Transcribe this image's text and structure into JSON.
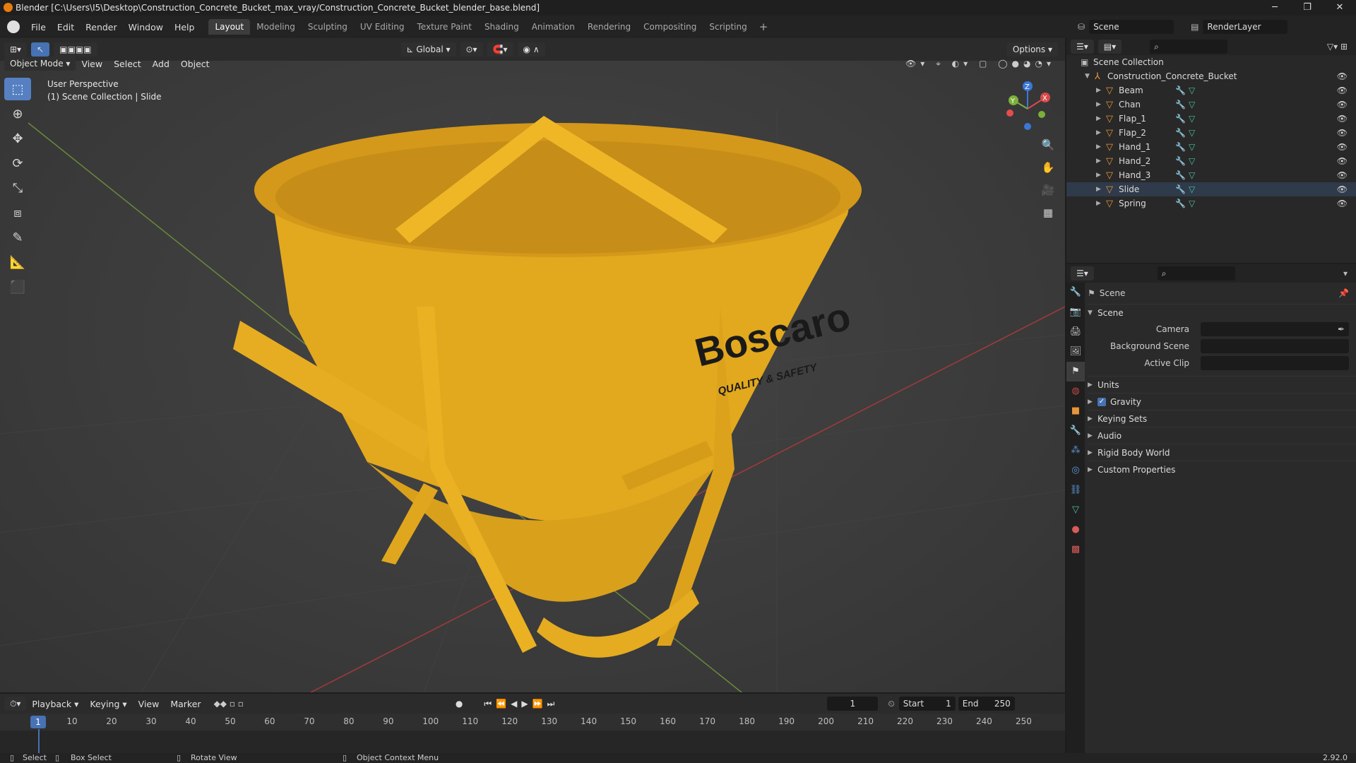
{
  "window": {
    "title": "Blender [C:\\Users\\I5\\Desktop\\Construction_Concrete_Bucket_max_vray/Construction_Concrete_Bucket_blender_base.blend]",
    "minimize": "─",
    "maximize": "❐",
    "close": "✕"
  },
  "menu": [
    "File",
    "Edit",
    "Render",
    "Window",
    "Help"
  ],
  "workspaces": [
    "Layout",
    "Modeling",
    "Sculpting",
    "UV Editing",
    "Texture Paint",
    "Shading",
    "Animation",
    "Rendering",
    "Compositing",
    "Scripting"
  ],
  "scene": {
    "scene_name": "Scene",
    "view_layer": "RenderLayer"
  },
  "viewport_header": {
    "transform": "Global",
    "options": "Options",
    "mode": "Object Mode",
    "menus": [
      "View",
      "Select",
      "Add",
      "Object"
    ]
  },
  "viewport_info": {
    "line1": "User Perspective",
    "line2": "(1) Scene Collection | Slide"
  },
  "gizmo": {
    "x": "X",
    "y": "Y",
    "z": "Z"
  },
  "model": {
    "brand": "Boscaro",
    "tagline": "QUALITY & SAFETY"
  },
  "timeline": {
    "menus": [
      "Playback",
      "Keying",
      "View",
      "Marker"
    ],
    "current_frame": "1",
    "start_label": "Start",
    "start": "1",
    "end_label": "End",
    "end": "250",
    "ticks": [
      "1",
      "10",
      "20",
      "30",
      "40",
      "50",
      "60",
      "70",
      "80",
      "90",
      "100",
      "110",
      "120",
      "130",
      "140",
      "150",
      "160",
      "170",
      "180",
      "190",
      "200",
      "210",
      "220",
      "230",
      "240",
      "250"
    ]
  },
  "statusbar": {
    "select": "Select",
    "box_select": "Box Select",
    "rotate": "Rotate View",
    "context": "Object Context Menu",
    "version": "2.92.0"
  },
  "outliner": {
    "root": "Scene Collection",
    "collection": "Construction_Concrete_Bucket",
    "objects": [
      "Beam",
      "Chan",
      "Flap_1",
      "Flap_2",
      "Hand_1",
      "Hand_2",
      "Hand_3",
      "Slide",
      "Spring"
    ]
  },
  "properties": {
    "header": "Scene",
    "panel": "Scene",
    "fields": [
      {
        "label": "Camera"
      },
      {
        "label": "Background Scene"
      },
      {
        "label": "Active Clip"
      }
    ],
    "panels": [
      "Units",
      "Gravity",
      "Keying Sets",
      "Audio",
      "Rigid Body World",
      "Custom Properties"
    ]
  },
  "colors": {
    "accent": "#4772b3",
    "bucket": "#e9b020",
    "object_icon": "#e8953a"
  }
}
